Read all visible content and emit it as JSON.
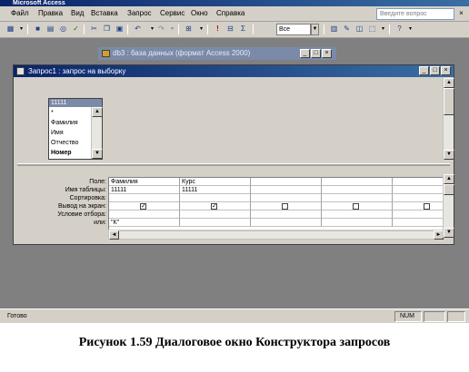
{
  "app": {
    "title": "Microsoft Access"
  },
  "menu": [
    "Файл",
    "Правка",
    "Вид",
    "Вставка",
    "Запрос",
    "Сервис",
    "Окно",
    "Справка"
  ],
  "help_box": {
    "placeholder": "Введите вопрос"
  },
  "toolbar": {
    "combo_value": "Все",
    "icons": [
      "view-icon",
      "save-icon",
      "print-icon",
      "preview-icon",
      "spell-icon",
      "cut-icon",
      "copy-icon",
      "paste-icon",
      "undo-icon",
      "redo-icon",
      "query-type-icon",
      "run-icon",
      "show-table-icon",
      "totals-icon",
      "properties-icon",
      "build-icon",
      "database-window-icon",
      "new-object-icon",
      "help-icon"
    ]
  },
  "db_window": {
    "title": "db3 : база данных (формат Access 2000)"
  },
  "query_window": {
    "title": "Запрос1 : запрос на выборку",
    "table": {
      "name": "11111",
      "fields": [
        "*",
        "Фамилия",
        "Имя",
        "Отчество",
        "Номер"
      ],
      "bold_field": "Номер"
    },
    "row_labels": [
      "Поле:",
      "Имя таблицы:",
      "Сортировка:",
      "Вывод на экран:",
      "Условие отбора:",
      "или:"
    ],
    "columns": [
      {
        "field": "Фамилия",
        "table": "11111",
        "sort": "",
        "show": true,
        "criteria": "",
        "or": "\"К\""
      },
      {
        "field": "Курс",
        "table": "11111",
        "sort": "",
        "show": true,
        "criteria": "",
        "or": ""
      },
      {
        "field": "",
        "table": "",
        "sort": "",
        "show": false,
        "criteria": "",
        "or": ""
      },
      {
        "field": "",
        "table": "",
        "sort": "",
        "show": false,
        "criteria": "",
        "or": ""
      },
      {
        "field": "",
        "table": "",
        "sort": "",
        "show": false,
        "criteria": "",
        "or": ""
      }
    ]
  },
  "status": {
    "left": "Готово",
    "num": "NUM"
  },
  "caption": "Рисунок 1.59 Диалоговое окно Конструктора запросов"
}
